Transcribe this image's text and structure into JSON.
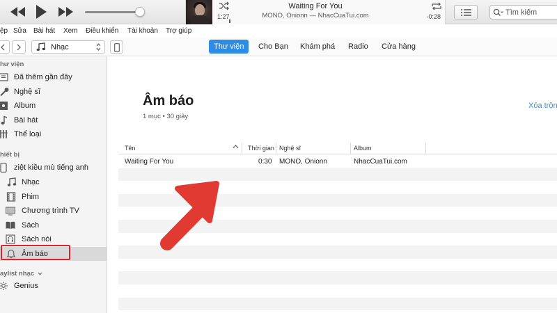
{
  "colors": {
    "accent": "#2f8ce4",
    "annotation_red": "#d9262e"
  },
  "player": {
    "now_playing": {
      "title": "Waiting For You",
      "subtitle": "MONO, Onionn — NhacCuaTui.com",
      "elapsed": "1:27",
      "remaining": "-0:28"
    },
    "search_placeholder": "Tìm kiếm"
  },
  "menu": [
    "ệp",
    "Sửa",
    "Bài hát",
    "Xem",
    "Điều khiển",
    "Tài khoản",
    "Trợ giúp"
  ],
  "nav": {
    "media_kind": "Nhạc",
    "tabs": [
      {
        "label": "Thư viện",
        "active": true
      },
      {
        "label": "Cho Bạn",
        "active": false
      },
      {
        "label": "Khám phá",
        "active": false
      },
      {
        "label": "Radio",
        "active": false
      },
      {
        "label": "Cửa hàng",
        "active": false
      }
    ]
  },
  "sidebar": {
    "library_header": "hư viện",
    "library": [
      {
        "label": "Đã thêm gần đây",
        "icon": "recently-added-icon"
      },
      {
        "label": "Nghệ sĩ",
        "icon": "microphone-icon"
      },
      {
        "label": "Album",
        "icon": "album-icon"
      },
      {
        "label": "Bài hát",
        "icon": "note-icon"
      },
      {
        "label": "Thể loại",
        "icon": "genre-icon"
      }
    ],
    "devices_header": "hiết bị",
    "device_name": "ziệt kiều mù tiếng anh",
    "device_items": [
      {
        "label": "Nhạc",
        "icon": "note-icon"
      },
      {
        "label": "Phim",
        "icon": "film-icon"
      },
      {
        "label": "Chương trình TV",
        "icon": "tv-icon"
      },
      {
        "label": "Sách",
        "icon": "book-icon"
      },
      {
        "label": "Sách nói",
        "icon": "audiobook-icon"
      },
      {
        "label": "Âm báo",
        "icon": "bell-icon",
        "selected": true
      }
    ],
    "playlists_header": "aylist nhạc",
    "playlists": [
      {
        "label": "Genius",
        "icon": "genius-icon"
      }
    ]
  },
  "main": {
    "title": "Âm báo",
    "subtitle": "1 mục • 30 giây",
    "clear_link": "Xóa trộn",
    "columns": {
      "name": "Tên",
      "time": "Thời gian",
      "artist": "Nghệ sĩ",
      "album": "Album"
    },
    "rows": [
      {
        "name": "Waiting For You",
        "time": "0:30",
        "artist": "MONO, Onionn",
        "album": "NhacCuaTui.com"
      }
    ]
  }
}
